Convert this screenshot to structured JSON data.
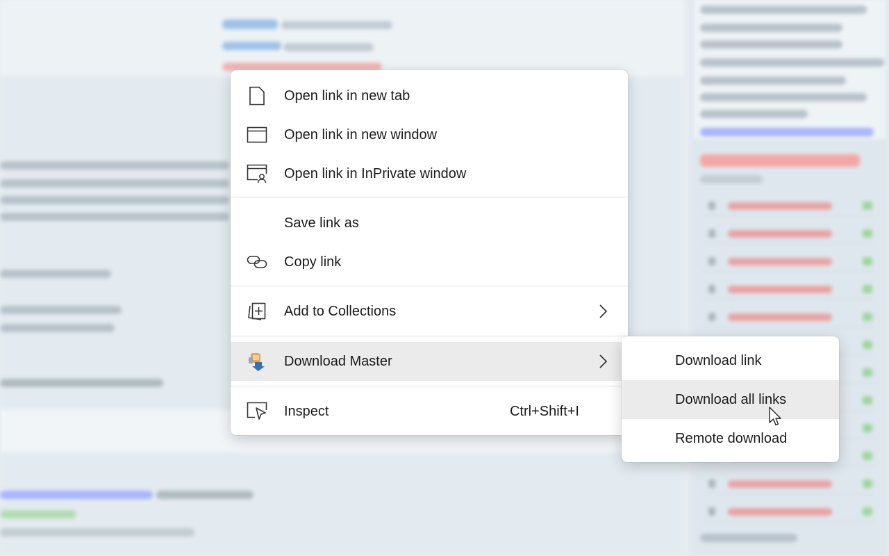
{
  "menu": {
    "items": [
      {
        "label": "Open link in new tab",
        "icon": "new-tab-icon"
      },
      {
        "label": "Open link in new window",
        "icon": "new-window-icon"
      },
      {
        "label": "Open link in InPrivate window",
        "icon": "inprivate-window-icon"
      },
      {
        "label": "Save link as",
        "icon": ""
      },
      {
        "label": "Copy link",
        "icon": "link-icon"
      },
      {
        "label": "Add to Collections",
        "icon": "collections-icon",
        "submenu": true
      },
      {
        "label": "Download Master",
        "icon": "download-master-icon",
        "submenu": true,
        "highlighted": true
      },
      {
        "label": "Inspect",
        "icon": "inspect-icon",
        "shortcut": "Ctrl+Shift+I"
      }
    ]
  },
  "submenu": {
    "items": [
      {
        "label": "Download link"
      },
      {
        "label": "Download all links",
        "highlighted": true
      },
      {
        "label": "Remote download"
      }
    ]
  },
  "colors": {
    "menu_bg": "#ffffff",
    "highlight": "#ebebeb",
    "text": "#1b1b1b"
  }
}
